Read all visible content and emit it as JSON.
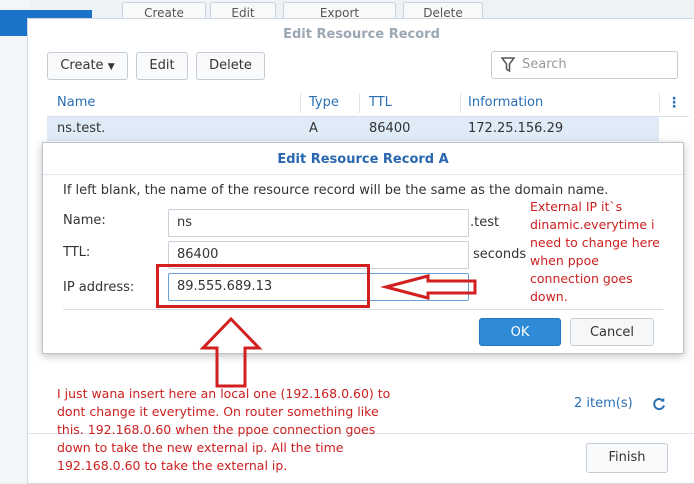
{
  "background": {
    "toolbar": [
      "Create",
      "Edit",
      "Export",
      "Delete"
    ]
  },
  "window": {
    "title": "Edit Resource Record",
    "toolbar": {
      "create_label": "Create",
      "edit_label": "Edit",
      "delete_label": "Delete",
      "search_placeholder": "Search"
    },
    "table": {
      "columns": [
        "Name",
        "Type",
        "TTL",
        "Information"
      ],
      "rows": [
        {
          "name": "ns.test.",
          "type": "A",
          "ttl": "86400",
          "info": "172.25.156.29"
        }
      ]
    },
    "item_count": "2 item(s)",
    "finish_label": "Finish"
  },
  "dialog": {
    "title": "Edit Resource Record A",
    "hint": "If left blank, the name of the resource record will be the same as the domain name.",
    "name_label": "Name:",
    "name_value": "ns",
    "name_suffix": ".test",
    "ttl_label": "TTL:",
    "ttl_value": "86400",
    "ttl_suffix": "seconds",
    "ip_label": "IP address:",
    "ip_value": "89.555.689.13",
    "ok_label": "OK",
    "cancel_label": "Cancel"
  },
  "annotations": {
    "right_note": [
      "External IP it`s",
      "dinamic.everytime i",
      "need to change here",
      "when ppoe",
      "connection goes",
      "down."
    ],
    "bottom_note": [
      "I just wana insert here an local one (192.168.0.60) to",
      "dont change it everytime. On router something like",
      "this. 192.168.0.60 when the ppoe connection goes",
      "down to take the new external ip. All the time",
      "192.168.0.60 to take the external ip."
    ],
    "color": "#d21f1f"
  },
  "colors": {
    "accent": "#2f8ad8",
    "link": "#2a6fb6",
    "selected_row": "#dfebf7"
  }
}
